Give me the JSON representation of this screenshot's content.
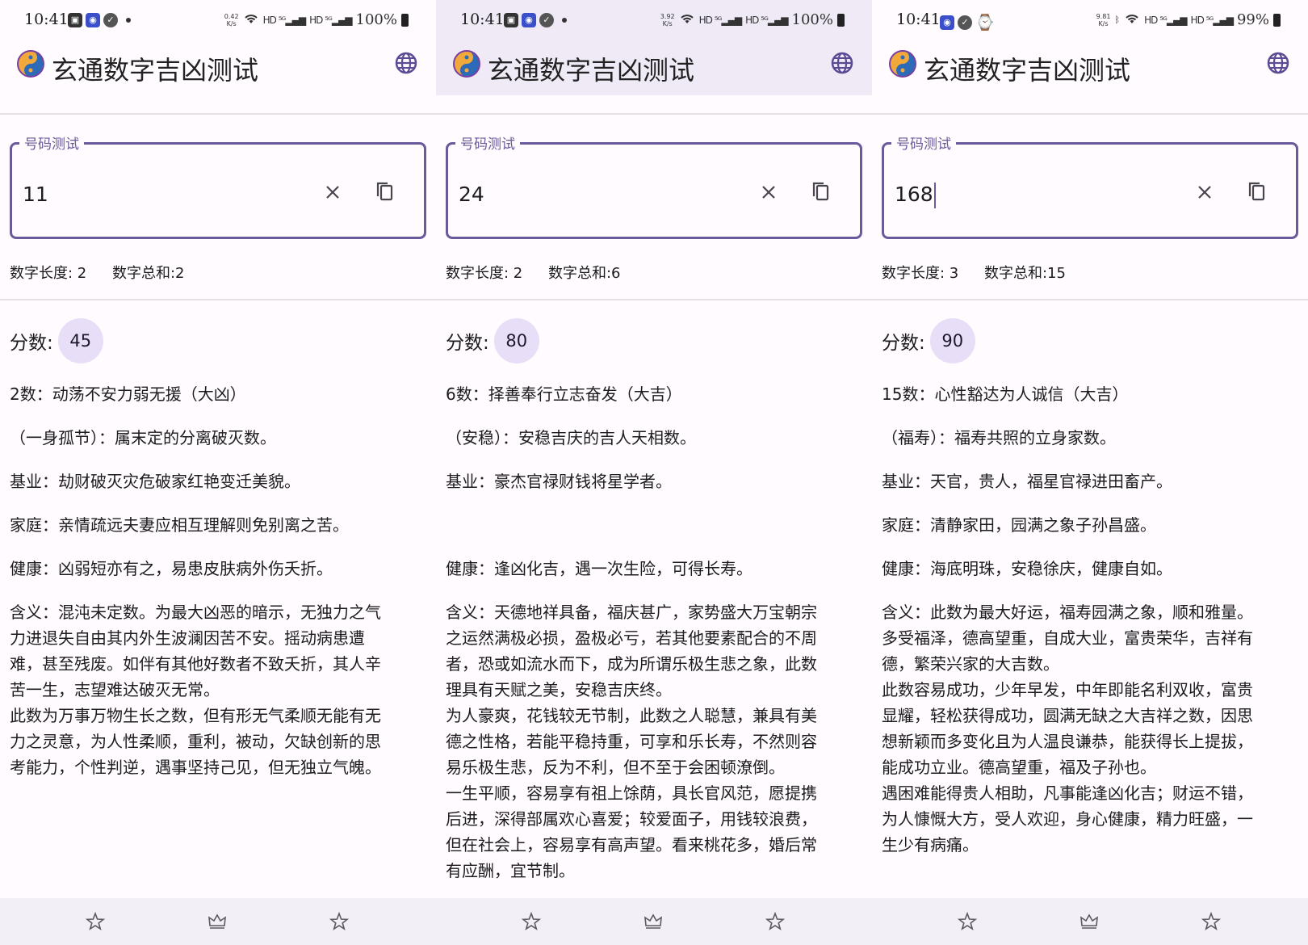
{
  "app": {
    "title": "玄通数字吉凶测试"
  },
  "colors": {
    "accent": "#6a5a9c",
    "badge_bg": "#e8def8",
    "nav_bg": "#f3eff6",
    "highlight_appbar": "#efeaf6"
  },
  "icons": {
    "logo": "taiji-logo-icon",
    "language": "globe-icon",
    "clear": "close-icon",
    "copy": "copy-icon",
    "nav": [
      "star-icon",
      "crown-icon",
      "star-icon"
    ]
  },
  "screens": [
    {
      "status": {
        "time": "10:41",
        "speed_top": "0.42",
        "speed_bottom": "K/s",
        "battery": "100%"
      },
      "field_label": "号码测试",
      "input_value": "11",
      "stats": {
        "length": "数字长度: 2",
        "sum": "数字总和:2"
      },
      "score_label": "分数:",
      "score": "45",
      "lines": {
        "title": "2数：动荡不安力弱无援（大凶）",
        "nickname": "（一身孤节）：属末定的分离破灭数。",
        "foundation": "基业：劫财破灭灾危破家红艳变迁美貌。",
        "family": "家庭：亲情疏远夫妻应相互理解则免别离之苦。",
        "health": "健康：凶弱短亦有之，易患皮肤病外伤夭折。"
      },
      "meaning": [
        "含义：混沌未定数。为最大凶恶的暗示，无独力之气",
        "力进退失自由其内外生波澜因苦不安。摇动病患遭",
        "难，甚至残废。如伴有其他好数者不致夭折，其人辛",
        "苦一生，志望难达破灭无常。",
        "此数为万事万物生长之数，但有形无气柔顺无能有无",
        "力之灵意，为人性柔顺，重利，被动，欠缺创新的思",
        "考能力，个性判逆，遇事坚持己见，但无独立气魄。"
      ]
    },
    {
      "status": {
        "time": "10:41",
        "speed_top": "3.92",
        "speed_bottom": "K/s",
        "battery": "100%"
      },
      "field_label": "号码测试",
      "input_value": "24",
      "stats": {
        "length": "数字长度: 2",
        "sum": "数字总和:6"
      },
      "score_label": "分数:",
      "score": "80",
      "lines": {
        "title": "6数：择善奉行立志奋发（大吉）",
        "nickname": "（安稳）：安稳吉庆的吉人天相数。",
        "foundation": "基业：豪杰官禄财钱将星学者。",
        "family": "",
        "health": "健康：逢凶化吉，遇一次生险，可得长寿。"
      },
      "meaning": [
        "含义：天德地祥具备，福庆甚广，家势盛大万宝朝宗",
        "之运然满极必损，盈极必亏，若其他要素配合的不周",
        "者，恐或如流水而下，成为所谓乐极生悲之象，此数",
        "理具有天赋之美，安稳吉庆终。",
        "为人豪爽，花钱较无节制，此数之人聪慧，兼具有美",
        "德之性格，若能平稳持重，可享和乐长寿，不然则容",
        "易乐极生悲，反为不利，但不至于会困顿潦倒。",
        "一生平顺，容易享有祖上馀荫，具长官风范，愿提携",
        "后进，深得部属欢心喜爱；较爱面子，用钱较浪费，",
        "但在社会上，容易享有高声望。看来桃花多，婚后常",
        "有应酬，宜节制。"
      ]
    },
    {
      "status": {
        "time": "10:41",
        "speed_top": "9.81",
        "speed_bottom": "K/s",
        "battery": "99%"
      },
      "field_label": "号码测试",
      "input_value": "168",
      "stats": {
        "length": "数字长度: 3",
        "sum": "数字总和:15"
      },
      "score_label": "分数:",
      "score": "90",
      "lines": {
        "title": "15数：心性豁达为人诚信（大吉）",
        "nickname": "（福寿）：福寿共照的立身家数。",
        "foundation": "基业：天官，贵人，福星官禄进田畜产。",
        "family": "家庭：清静家田，园满之象子孙昌盛。",
        "health": "健康：海底明珠，安稳徐庆，健康自如。"
      },
      "meaning": [
        "含义：此数为最大好运，福寿园满之象，顺和雅量。",
        "多受福泽，德高望重，自成大业，富贵荣华，吉祥有",
        "德，繁荣兴家的大吉数。",
        "此数容易成功，少年早发，中年即能名利双收，富贵",
        "显耀，轻松获得成功，圆满无缺之大吉祥之数，因思",
        "想新颖而多变化且为人温良谦恭，能获得长上提拔，",
        "能成功立业。德高望重，福及子孙也。",
        "遇困难能得贵人相助，凡事能逢凶化吉；财运不错，",
        "为人慷慨大方，受人欢迎，身心健康，精力旺盛，一",
        "生少有病痛。"
      ]
    }
  ]
}
